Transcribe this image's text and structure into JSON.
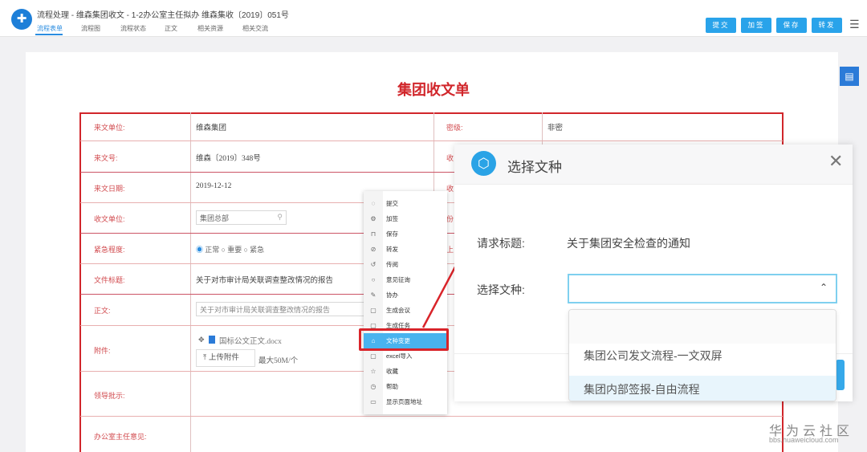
{
  "header": {
    "title": "流程处理 - 维森集团收文 - 1-2办公室主任拟办 维森集收〔2019〕051号",
    "tabs": [
      "流程表单",
      "流程图",
      "流程状态",
      "正文",
      "相关资源",
      "相关交流"
    ],
    "buttons": [
      "提交",
      "加签",
      "保存",
      "转发"
    ]
  },
  "form": {
    "title": "集团收文单",
    "rows": [
      {
        "label": "来文单位:",
        "value": "维森集团"
      },
      {
        "label": "来文号:",
        "value": "维森〔2019〕348号"
      },
      {
        "label": "来文日期:",
        "value": "2019-12-12"
      },
      {
        "label": "收文单位:",
        "value": "集团总部"
      },
      {
        "label": "紧急程度:",
        "options": [
          "正常",
          "重要",
          "紧急"
        ],
        "selected": "正常"
      },
      {
        "label": "文件标题:",
        "value": "关于对市审计局关联调查整改情况的报告"
      },
      {
        "label": "正文:",
        "value": "关于对市审计局关联调查整改情况的报告"
      },
      {
        "label": "附件:",
        "file": "国标公文正文.docx",
        "upload": "上传附件",
        "limit": "最大50M/个"
      },
      {
        "label": "领导批示:"
      },
      {
        "label": "办公室主任意见:"
      }
    ],
    "right": [
      {
        "label": "密级:",
        "value": "非密"
      },
      {
        "label": "收"
      },
      {
        "label": "收"
      },
      {
        "label": "份"
      },
      {
        "label": "上"
      }
    ]
  },
  "context_menu": [
    {
      "label": "提交",
      "icon": "check-circle-icon"
    },
    {
      "label": "加签",
      "icon": "gear-icon"
    },
    {
      "label": "保存",
      "icon": "save-icon"
    },
    {
      "label": "转发",
      "icon": "forward-icon"
    },
    {
      "label": "传阅",
      "icon": "circulate-icon"
    },
    {
      "label": "意见征询",
      "icon": "comment-icon"
    },
    {
      "label": "协办",
      "icon": "assist-icon"
    },
    {
      "label": "生成会议",
      "icon": "meeting-icon"
    },
    {
      "label": "生成任务",
      "icon": "task-icon"
    },
    {
      "label": "文种变更",
      "icon": "change-icon",
      "selected": true
    },
    {
      "label": "excel导入",
      "icon": "import-icon"
    },
    {
      "label": "收藏",
      "icon": "star-icon"
    },
    {
      "label": "帮助",
      "icon": "help-icon"
    },
    {
      "label": "显示页面地址",
      "icon": "window-icon"
    }
  ],
  "dialog": {
    "title": "选择文种",
    "request_label": "请求标题:",
    "request_value": "关于集团安全检查的通知",
    "type_label": "选择文种:",
    "type_value": "",
    "options": [
      "",
      "集团公司发文流程-一文双屏",
      "集团内部签报-自由流程"
    ],
    "highlighted": 2
  },
  "watermark": {
    "brand": "华为云社区",
    "url": "bbs.huaweicloud.com"
  }
}
